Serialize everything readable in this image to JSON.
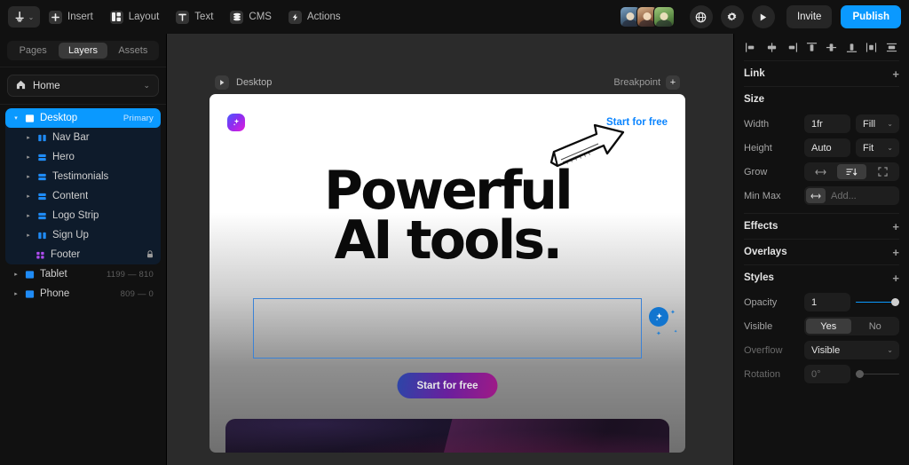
{
  "topbar": {
    "logo_caret": "⌄",
    "menu": [
      {
        "label": "Insert",
        "icon": "plus-icon"
      },
      {
        "label": "Layout",
        "icon": "layout-icon"
      },
      {
        "label": "Text",
        "icon": "text-icon"
      },
      {
        "label": "CMS",
        "icon": "database-icon"
      },
      {
        "label": "Actions",
        "icon": "bolt-icon"
      }
    ],
    "collaborators": [
      "avatar-1",
      "avatar-2",
      "avatar-3"
    ],
    "globe_icon": "globe-icon",
    "settings_icon": "gear-icon",
    "preview_icon": "play-icon",
    "invite_label": "Invite",
    "publish_label": "Publish",
    "publish_color": "#0a99ff"
  },
  "sidebar": {
    "tabs": [
      {
        "label": "Pages",
        "active": false
      },
      {
        "label": "Layers",
        "active": true
      },
      {
        "label": "Assets",
        "active": false
      }
    ],
    "page_selector": {
      "label": "Home",
      "icon": "home-icon",
      "chevron": "⌄"
    },
    "layers": [
      {
        "label": "Desktop",
        "badge": "Primary",
        "icon": "frame-icon",
        "selected": true,
        "twisty": "▾",
        "depth": 0
      },
      {
        "label": "Nav Bar",
        "icon": "columns-icon",
        "depth": 1,
        "twisty": "▸"
      },
      {
        "label": "Hero",
        "icon": "stack-icon",
        "depth": 1,
        "twisty": "▸"
      },
      {
        "label": "Testimonials",
        "icon": "stack-icon",
        "depth": 1,
        "twisty": "▸"
      },
      {
        "label": "Content",
        "icon": "stack-icon",
        "depth": 1,
        "twisty": "▸"
      },
      {
        "label": "Logo Strip",
        "icon": "stack-icon",
        "depth": 1,
        "twisty": "▸"
      },
      {
        "label": "Sign Up",
        "icon": "columns-icon",
        "depth": 1,
        "twisty": "▸"
      },
      {
        "label": "Footer",
        "icon": "grid-icon",
        "depth": 1,
        "lock": "🔒"
      },
      {
        "label": "Tablet",
        "dimensions": "1199 — 810",
        "icon": "frame-icon",
        "depth": 0,
        "twisty": "▸"
      },
      {
        "label": "Phone",
        "dimensions": "809 — 0",
        "icon": "frame-icon",
        "depth": 0,
        "twisty": "▸"
      }
    ]
  },
  "canvas": {
    "frame_name": "Desktop",
    "frame_play_icon": "play-icon",
    "breakpoint_label": "Breakpoint",
    "breakpoint_add": "+",
    "site": {
      "brand_icon": "sparkle-logo-icon",
      "nav_cta": "Start for free",
      "nav_cta_color": "#0a84ff",
      "heading_line1": "Powerful",
      "heading_line2": "AI tools.",
      "arrow_annotation": "hand-drawn-arrow-icon",
      "cta_label": "Start for free",
      "ai_badge_icon": "ai-sparkle-icon",
      "selection_color": "#3b82d6"
    }
  },
  "properties": {
    "align_icons": [
      "align-left-icon",
      "align-center-horizontal-icon",
      "align-right-icon",
      "align-top-icon",
      "align-center-vertical-icon",
      "align-bottom-icon",
      "distribute-horizontal-icon",
      "distribute-vertical-icon"
    ],
    "sections": {
      "link": {
        "title": "Link",
        "add": "+"
      },
      "size": {
        "title": "Size",
        "width": {
          "label": "Width",
          "value": "1fr",
          "mode": "Fill",
          "chevron": "⌄"
        },
        "height": {
          "label": "Height",
          "value": "Auto",
          "mode": "Fit",
          "chevron": "⌄"
        },
        "grow": {
          "label": "Grow",
          "options": [
            {
              "icon": "arrows-horizontal-icon",
              "on": false
            },
            {
              "icon": "grow-vertical-icon",
              "on": true
            },
            {
              "icon": "expand-icon",
              "on": false
            }
          ]
        },
        "minmax": {
          "label": "Min Max",
          "icon": "arrows-horizontal-icon",
          "placeholder": "Add..."
        }
      },
      "effects": {
        "title": "Effects",
        "add": "+"
      },
      "overlays": {
        "title": "Overlays",
        "add": "+"
      },
      "styles": {
        "title": "Styles",
        "add": "+",
        "opacity": {
          "label": "Opacity",
          "value": "1",
          "slider_pct": 100
        },
        "visible": {
          "label": "Visible",
          "yes": "Yes",
          "no": "No",
          "selected": "Yes"
        },
        "overflow": {
          "label": "Overflow",
          "value": "Visible",
          "chevron": "⌄"
        },
        "rotation": {
          "label": "Rotation",
          "value": "0°",
          "slider_pct": 0
        }
      }
    }
  }
}
